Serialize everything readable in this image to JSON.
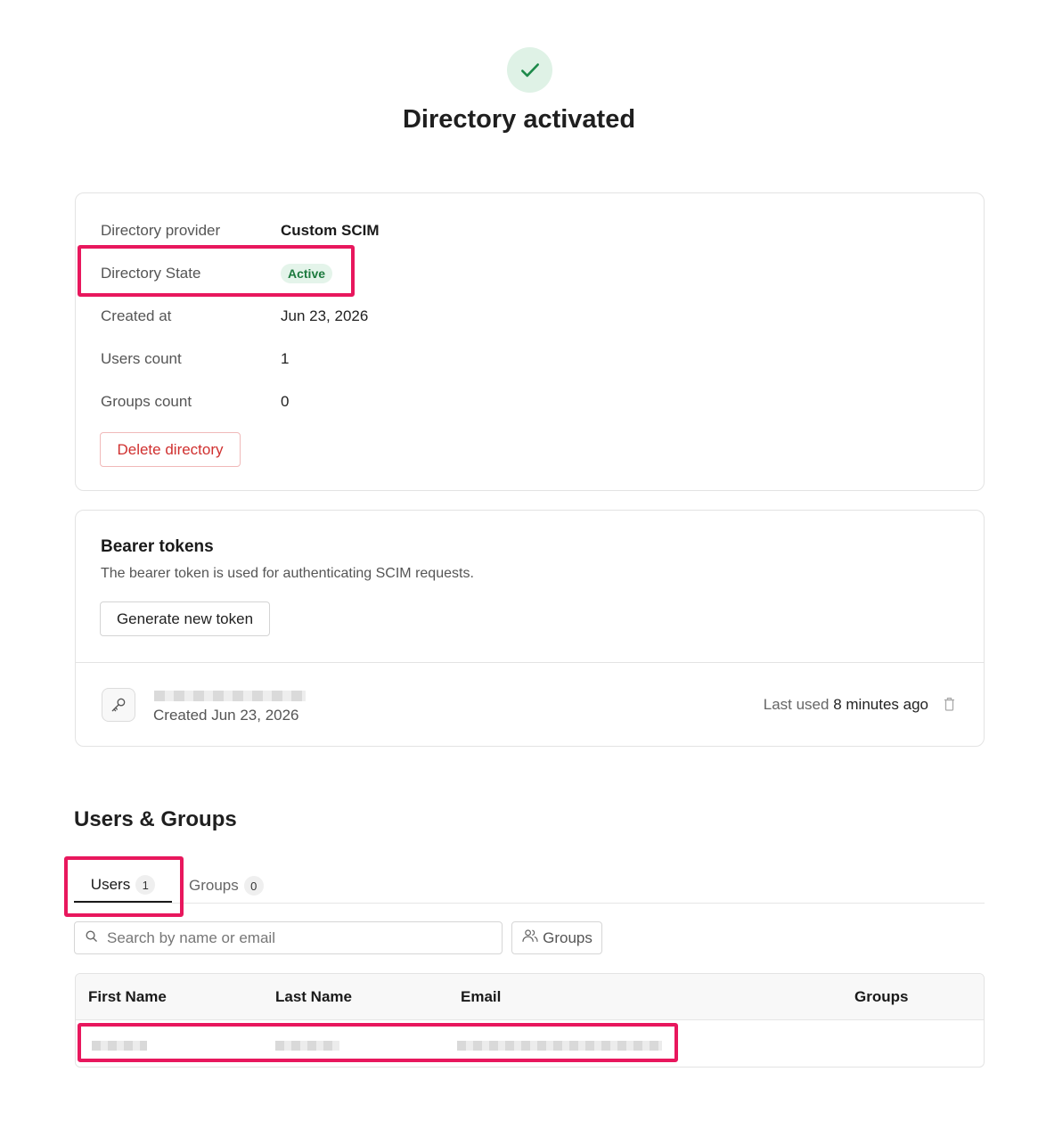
{
  "header": {
    "title": "Directory activated",
    "icon": "check-icon"
  },
  "directory": {
    "rows": [
      {
        "label": "Directory provider",
        "value": "Custom SCIM"
      },
      {
        "label": "Directory State",
        "value": "Active"
      },
      {
        "label": "Created at",
        "value": "Jun 23, 2026"
      },
      {
        "label": "Users count",
        "value": "1"
      },
      {
        "label": "Groups count",
        "value": "0"
      }
    ],
    "delete_label": "Delete directory"
  },
  "tokens": {
    "title": "Bearer tokens",
    "description": "The bearer token is used for authenticating SCIM requests.",
    "generate_label": "Generate new token",
    "item": {
      "created": "Created Jun 23, 2026",
      "last_used_prefix": "Last used",
      "last_used_value": "8 minutes ago"
    }
  },
  "users_groups": {
    "title": "Users & Groups",
    "tabs": [
      {
        "label": "Users",
        "count": "1",
        "active": true
      },
      {
        "label": "Groups",
        "count": "0",
        "active": false
      }
    ],
    "search_placeholder": "Search by name or email",
    "groups_filter_label": "Groups",
    "table": {
      "columns": [
        "First Name",
        "Last Name",
        "Email",
        "Groups"
      ]
    }
  },
  "colors": {
    "highlight": "#e8175d",
    "success": "#1d7a3e",
    "danger": "#d0302f"
  }
}
